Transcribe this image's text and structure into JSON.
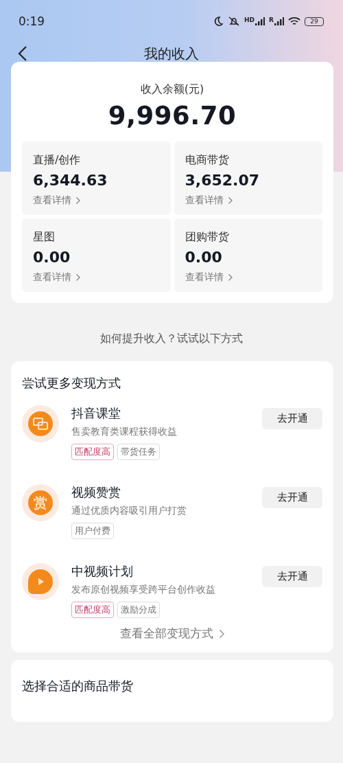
{
  "status_bar": {
    "time": "0:19",
    "signal_1_label": "HD",
    "signal_2_label": "R",
    "battery": "29"
  },
  "header": {
    "title": "我的收入"
  },
  "balance": {
    "label": "收入余额(元)",
    "amount": "9,996.70",
    "tiles": [
      {
        "label": "直播/创作",
        "amount": "6,344.63",
        "link": "查看详情"
      },
      {
        "label": "电商带货",
        "amount": "3,652.07",
        "link": "查看详情"
      },
      {
        "label": "星图",
        "amount": "0.00",
        "link": "查看详情"
      },
      {
        "label": "团购带货",
        "amount": "0.00",
        "link": "查看详情"
      }
    ]
  },
  "tip": "如何提升收入？试试以下方式",
  "monetize": {
    "title": "尝试更多变现方式",
    "items": [
      {
        "kind": "course",
        "title": "抖音课堂",
        "desc": "售卖教育类课程获得收益",
        "button": "去开通",
        "tags": [
          {
            "text": "匹配度高",
            "highlight": true
          },
          {
            "text": "带货任务",
            "highlight": false
          }
        ]
      },
      {
        "kind": "reward",
        "glyph": "赏",
        "title": "视频赞赏",
        "desc": "通过优质内容吸引用户打赏",
        "button": "去开通",
        "tags": [
          {
            "text": "用户付费",
            "highlight": false
          }
        ]
      },
      {
        "kind": "video",
        "title": "中视频计划",
        "desc": "发布原创视频享受跨平台创作收益",
        "button": "去开通",
        "tags": [
          {
            "text": "匹配度高",
            "highlight": true
          },
          {
            "text": "激励分成",
            "highlight": false
          }
        ]
      }
    ],
    "more": "查看全部变现方式"
  },
  "goods": {
    "title": "选择合适的商品带货"
  }
}
